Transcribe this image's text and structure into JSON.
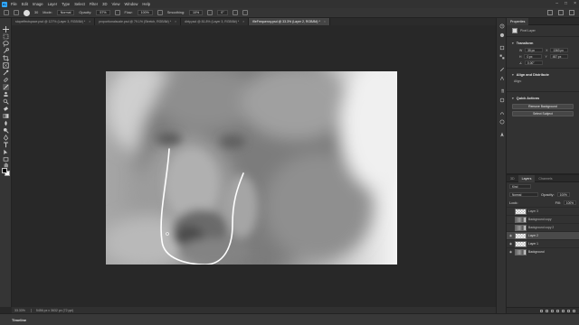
{
  "menu": [
    "File",
    "Edit",
    "Image",
    "Layer",
    "Type",
    "Select",
    "Filter",
    "3D",
    "View",
    "Window",
    "Help"
  ],
  "options": {
    "brush_size": "30",
    "mode_label": "Mode:",
    "mode_value": "Normal",
    "opacity_label": "Opacity:",
    "opacity_value": "57%",
    "flow_label": "Flow:",
    "flow_value": "100%",
    "smoothing_label": "Smoothing:",
    "smoothing_value": "10%",
    "angle_value": "0°"
  },
  "tabs": [
    {
      "label": "stopeffectspace.psd @ 127% (Layer 3, RGB/8#) *",
      "active": false
    },
    {
      "label": "proportionalscale.psd @ 79.1% (Stretch, RGB/8#) *",
      "active": false
    },
    {
      "label": "dirty.psd @ 81.8% (Layer 3, RGB/8#) *",
      "active": false
    },
    {
      "label": "fileFrequency.psd @ 33.3% (Layer 2, RGB/8#) *",
      "active": true
    }
  ],
  "status": {
    "zoom": "33.33%",
    "doc_size": "5456 px x 3632 px (72 ppi)"
  },
  "timeline_label": "Timeline",
  "properties": {
    "panel_title": "Properties",
    "layer_type": "Pixel Layer",
    "transform_title": "Transform",
    "w_label": "W",
    "w_value": "35 px",
    "h_label": "H",
    "h_value": "0 px",
    "x_label": "X",
    "x_value": "1363 px",
    "y_label": "Y",
    "y_value": "457 px",
    "angle_value": "0.00°",
    "align_title": "Align and Distribute",
    "align_label": "Align:",
    "quick_actions_title": "Quick Actions",
    "qa_buttons": [
      "Remove Background",
      "Select Subject"
    ]
  },
  "layers_panel": {
    "tabs": [
      "3D",
      "Layers",
      "Channels"
    ],
    "kind_filter": "Kind",
    "blend_mode": "Normal",
    "opacity_label": "Opacity:",
    "opacity_value": "100%",
    "lock_label": "Lock:",
    "fill_label": "Fill:",
    "fill_value": "100%",
    "layers": [
      {
        "name": "Layer 3",
        "selected": false,
        "visible": false,
        "photo": false
      },
      {
        "name": "Background copy",
        "selected": false,
        "visible": false,
        "photo": true
      },
      {
        "name": "Background copy 2",
        "selected": false,
        "visible": false,
        "photo": true
      },
      {
        "name": "Layer 2",
        "selected": true,
        "visible": true,
        "photo": false
      },
      {
        "name": "Layer 1",
        "selected": false,
        "visible": true,
        "photo": false
      },
      {
        "name": "Background",
        "selected": false,
        "visible": true,
        "photo": true
      }
    ]
  },
  "colors": {
    "accent": "#31a8ff",
    "foreground": "#000000",
    "background": "#ffffff"
  },
  "toolbar_icons": [
    "move-tool-icon",
    "marquee-tool-icon",
    "lasso-tool-icon",
    "quick-select-icon",
    "crop-tool-icon",
    "frame-tool-icon",
    "eyedropper-icon",
    "healing-brush-icon",
    "brush-tool-icon",
    "clone-stamp-icon",
    "history-brush-icon",
    "eraser-icon",
    "gradient-tool-icon",
    "blur-tool-icon",
    "dodge-tool-icon",
    "pen-tool-icon",
    "type-tool-icon",
    "path-select-icon",
    "rectangle-tool-icon",
    "hand-tool-icon",
    "zoom-tool-icon"
  ]
}
